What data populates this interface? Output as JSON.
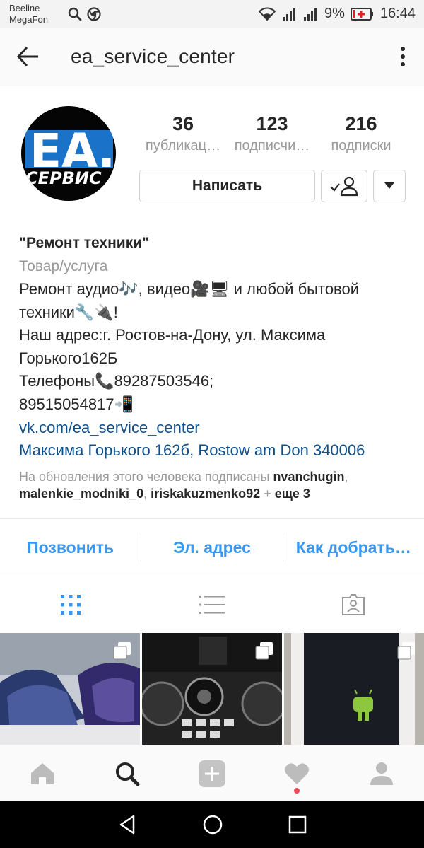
{
  "status_bar": {
    "carrier1": "Beeline",
    "carrier2": "MegaFon",
    "battery": "9%",
    "time": "16:44"
  },
  "header": {
    "username": "ea_service_center"
  },
  "profile": {
    "avatar_text_top": "ЕА.",
    "avatar_text_bottom": "СЕРВИС",
    "stats": [
      {
        "value": "36",
        "label": "публикац…"
      },
      {
        "value": "123",
        "label": "подписчи…"
      },
      {
        "value": "216",
        "label": "подписки"
      }
    ],
    "message_button": "Написать"
  },
  "bio": {
    "name": "\"Ремонт  техники\"",
    "category": "Товар/услуга",
    "lines": [
      "Ремонт аудио🎶, видео🎥🖥 и любой бытовой",
      "техники🔧🔌!",
      "Наш адрес:г. Ростов-на-Дону, ул. Максима",
      "Горького162Б",
      "Телефоны📞89287503546;",
      "89515054817📲"
    ],
    "link": "vk.com/ea_service_center",
    "address": "Максима Горького 162б, Rostow am Don 340006",
    "followed_prefix": "На обновления этого человека подписаны ",
    "followed_user1": "nvanchugin",
    "followed_sep1": ",",
    "followed_user2": "malenkie_modniki_0",
    "followed_sep2": ", ",
    "followed_user3": "iriskakuzmenko92",
    "followed_plus": " + ",
    "followed_more": "еще 3"
  },
  "contacts": [
    "Позвонить",
    "Эл. адрес",
    "Как добрать…"
  ],
  "tabs": [
    "grid-icon",
    "list-icon",
    "tagged-icon"
  ],
  "bottom_nav": [
    "home-icon",
    "search-icon",
    "add-icon",
    "heart-icon",
    "profile-icon"
  ],
  "colors": {
    "accent": "#3897f0",
    "link": "#0d4f8b",
    "notification": "#ed4956"
  }
}
